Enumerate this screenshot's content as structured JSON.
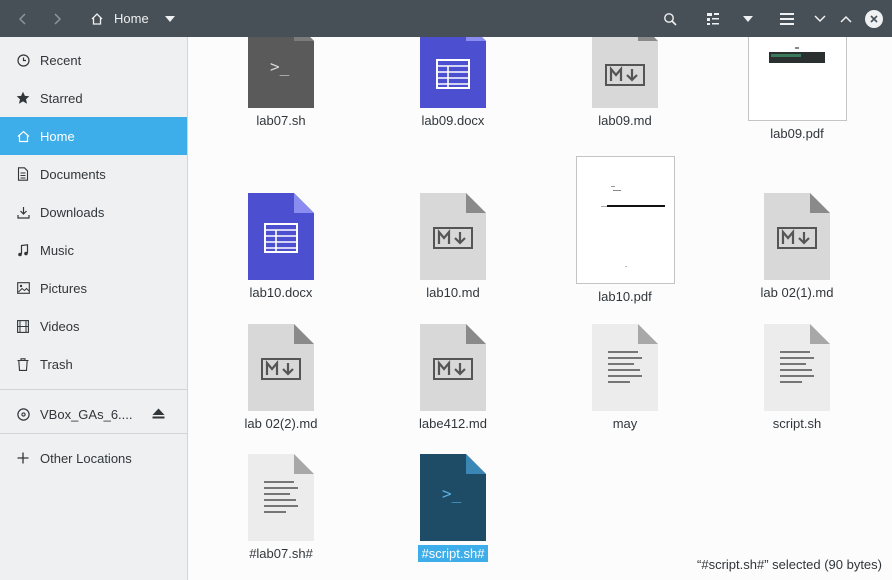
{
  "header": {
    "location": "Home",
    "icons": [
      "back-arrow",
      "forward-arrow",
      "home",
      "dropdown",
      "search",
      "view-options",
      "dropdown",
      "menu",
      "chevron-down",
      "chevron-up",
      "close"
    ]
  },
  "sidebar": {
    "items": [
      {
        "label": "Recent",
        "icon": "clock"
      },
      {
        "label": "Starred",
        "icon": "star"
      },
      {
        "label": "Home",
        "icon": "home",
        "active": true
      },
      {
        "label": "Documents",
        "icon": "document"
      },
      {
        "label": "Downloads",
        "icon": "download"
      },
      {
        "label": "Music",
        "icon": "music"
      },
      {
        "label": "Pictures",
        "icon": "picture"
      },
      {
        "label": "Videos",
        "icon": "film"
      },
      {
        "label": "Trash",
        "icon": "trash"
      }
    ],
    "device": {
      "label": "VBox_GAs_6....",
      "icon": "disc"
    },
    "other": {
      "label": "Other Locations",
      "icon": "plus"
    }
  },
  "files": [
    {
      "name": "lab07.sh",
      "type": "terminal"
    },
    {
      "name": "lab09.docx",
      "type": "docx"
    },
    {
      "name": "lab09.md",
      "type": "markdown"
    },
    {
      "name": "lab09.pdf",
      "type": "pdf"
    },
    {
      "name": "lab10.docx",
      "type": "docx"
    },
    {
      "name": "lab10.md",
      "type": "markdown"
    },
    {
      "name": "lab10.pdf",
      "type": "pdf"
    },
    {
      "name": "lab 02(1).md",
      "type": "markdown"
    },
    {
      "name": "lab 02(2).md",
      "type": "markdown"
    },
    {
      "name": "labe412.md",
      "type": "markdown"
    },
    {
      "name": "may",
      "type": "text"
    },
    {
      "name": "script.sh",
      "type": "text"
    },
    {
      "name": "#lab07.sh#",
      "type": "text"
    },
    {
      "name": "#script.sh#",
      "type": "terminal-dark",
      "selected": true
    }
  ],
  "status": "“#script.sh#” selected  (90 bytes)",
  "colors": {
    "accent": "#3daee9",
    "headerbar": "#475057",
    "docx": "#4c4fcf",
    "terminal": "#5a5a5a",
    "terminal_dark": "#1e4b66"
  }
}
